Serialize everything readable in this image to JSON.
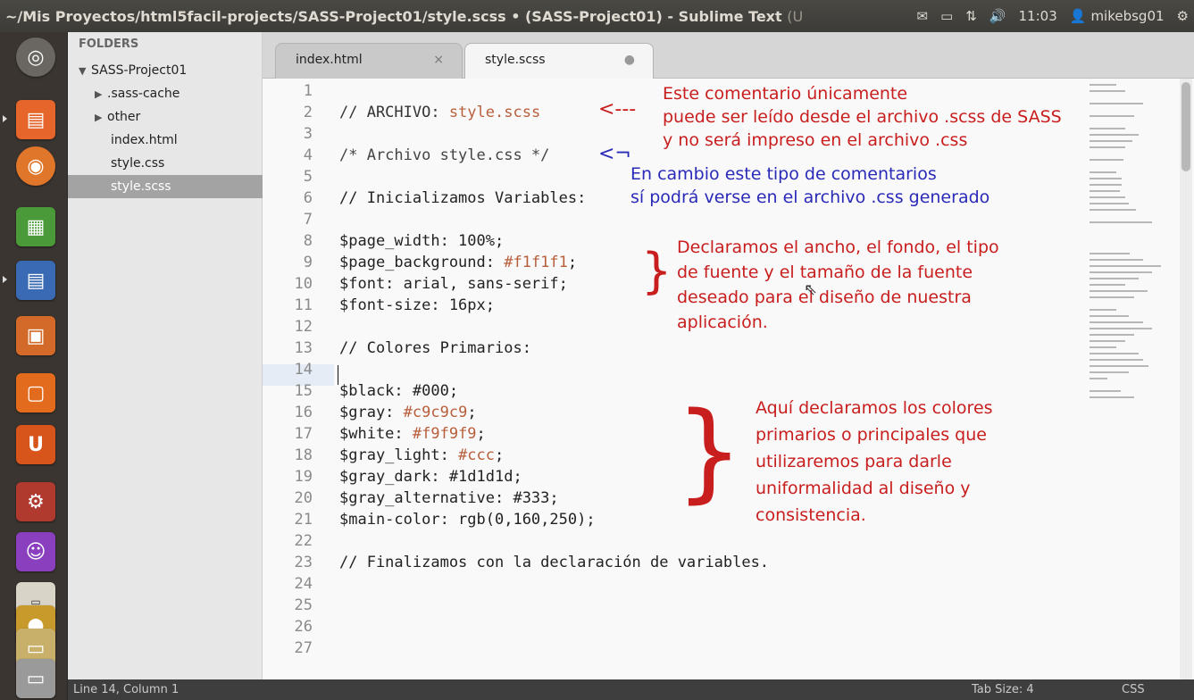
{
  "window": {
    "title": "~/Mis Proyectos/html5facil-projects/SASS-Project01/style.scss • (SASS-Project01) - Sublime Text",
    "title_suffix": "(U"
  },
  "panel": {
    "clock": "11:03",
    "user": "mikebsg01"
  },
  "sidebar": {
    "header": "FOLDERS",
    "project": "SASS-Project01",
    "items": [
      {
        "label": ".sass-cache",
        "type": "folder"
      },
      {
        "label": "other",
        "type": "folder"
      },
      {
        "label": "index.html",
        "type": "file"
      },
      {
        "label": "style.css",
        "type": "file"
      },
      {
        "label": "style.scss",
        "type": "file",
        "selected": true
      }
    ]
  },
  "tabs": [
    {
      "label": "index.html",
      "close": "×"
    },
    {
      "label": "style.scss",
      "close": "●"
    }
  ],
  "editor": {
    "line_numbers": [
      "1",
      "2",
      "3",
      "4",
      "5",
      "6",
      "7",
      "8",
      "9",
      "10",
      "11",
      "12",
      "13",
      "14",
      "15",
      "16",
      "17",
      "18",
      "19",
      "20",
      "21",
      "22",
      "23",
      "24",
      "25",
      "26",
      "27"
    ],
    "lines": {
      "l2a": "// ARCHIVO: ",
      "l2b": "style.scss",
      "l4": "/* Archivo style.css */",
      "l6": "// Inicializamos Variables:",
      "l8": "$page_width: 100%;",
      "l9a": "$page_background: ",
      "l9b": "#f1f1f1",
      "l9c": ";",
      "l10": "$font: arial, sans-serif;",
      "l11": "$font-size: 16px;",
      "l13": "// Colores Primarios:",
      "l15": "$black: #000;",
      "l16a": "$gray: ",
      "l16b": "#c9c9c9",
      "l16c": ";",
      "l17a": "$white: ",
      "l17b": "#f9f9f9",
      "l17c": ";",
      "l18a": "$gray_light: ",
      "l18b": "#ccc",
      "l18c": ";",
      "l19": "$gray_dark: #1d1d1d;",
      "l20": "$gray_alternative: #333;",
      "l21": "$main-color: rgb(0,160,250);",
      "l23": "// Finalizamos con la declaración de variables."
    }
  },
  "annotations": {
    "a1_arrow": "<---",
    "a1_l1": "Este comentario únicamente",
    "a1_l2": "puede ser leído desde el archivo .scss de SASS",
    "a1_l3": "y no será impreso en el archivo .css",
    "a2_arrow": "<¬",
    "a2_l1": "En cambio este tipo de comentarios",
    "a2_l2": "sí podrá verse en el archivo .css generado",
    "a3_brace": "}",
    "a3_l1": "Declaramos el ancho, el fondo, el tipo",
    "a3_l2": "de fuente y el tamaño de la fuente",
    "a3_l3": "deseado para el diseño de nuestra",
    "a3_l4": "aplicación.",
    "a4_brace": "}",
    "a4_l1": "Aquí declaramos los colores",
    "a4_l2": "primarios o principales que",
    "a4_l3": "utilizaremos para darle",
    "a4_l4": "uniformalidad al diseño y",
    "a4_l5": "consistencia."
  },
  "status": {
    "position": "Line 14, Column 1",
    "tab_size": "Tab Size: 4",
    "syntax": "CSS"
  },
  "colors": {
    "annotation_red": "#c81e1e",
    "annotation_blue": "#2a2ab8",
    "value_highlight": "#b85e3a"
  }
}
